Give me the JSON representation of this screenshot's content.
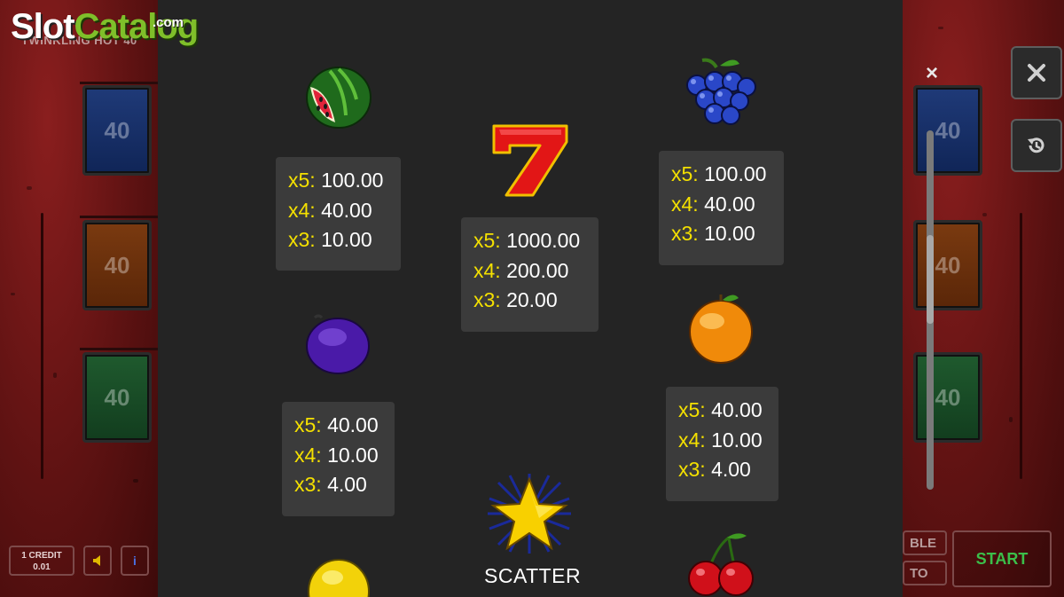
{
  "logo": {
    "part1": "Slot",
    "part2": "Catalog",
    "suffix": ".com"
  },
  "game_title": "TWINKLING HOT 40",
  "lines_boxes": [
    "40",
    "40",
    "40"
  ],
  "right_lines_boxes": [
    "40",
    "40",
    "40"
  ],
  "bottom_left": {
    "credit_line1": "1 CREDIT",
    "credit_line2": "0.01",
    "sound_icon": "speaker-icon",
    "info_label": "i"
  },
  "bottom_right": {
    "gamble_label": "BLE",
    "auto_label": "TO",
    "start_label": "START"
  },
  "side_buttons": {
    "close_icon": "close-icon",
    "history_icon": "history-icon"
  },
  "paytable": {
    "close_label": "×",
    "symbols": [
      {
        "name": "watermelon",
        "pays": [
          {
            "m": "x5:",
            "v": "100.00"
          },
          {
            "m": "x4:",
            "v": "40.00"
          },
          {
            "m": "x3:",
            "v": "10.00"
          }
        ]
      },
      {
        "name": "seven",
        "pays": [
          {
            "m": "x5:",
            "v": "1000.00"
          },
          {
            "m": "x4:",
            "v": "200.00"
          },
          {
            "m": "x3:",
            "v": "20.00"
          }
        ]
      },
      {
        "name": "grapes",
        "pays": [
          {
            "m": "x5:",
            "v": "100.00"
          },
          {
            "m": "x4:",
            "v": "40.00"
          },
          {
            "m": "x3:",
            "v": "10.00"
          }
        ]
      },
      {
        "name": "plum",
        "pays": [
          {
            "m": "x5:",
            "v": "40.00"
          },
          {
            "m": "x4:",
            "v": "10.00"
          },
          {
            "m": "x3:",
            "v": "4.00"
          }
        ]
      },
      {
        "name": "orange",
        "pays": [
          {
            "m": "x5:",
            "v": "40.00"
          },
          {
            "m": "x4:",
            "v": "10.00"
          },
          {
            "m": "x3:",
            "v": "4.00"
          }
        ]
      }
    ],
    "scatter_label": "SCATTER"
  },
  "colors": {
    "multiplier": "#f4e000",
    "value": "#ffffff",
    "panel": "#242424",
    "box": "#3b3b3b"
  }
}
